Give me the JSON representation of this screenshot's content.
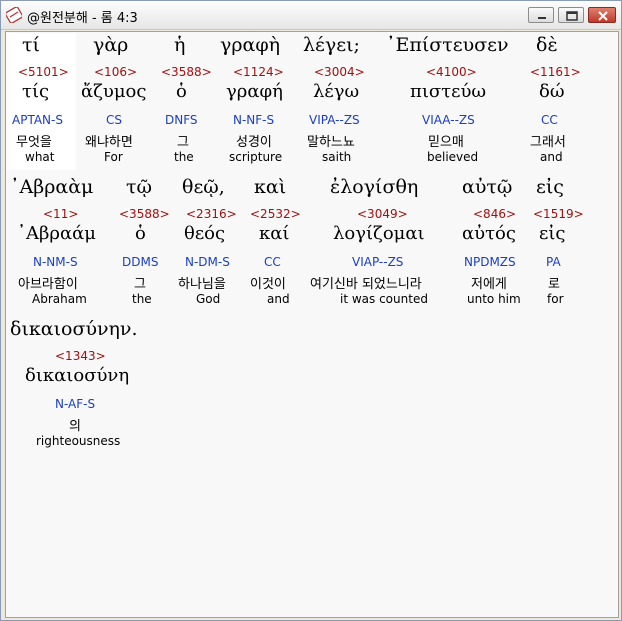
{
  "window": {
    "title": "@원전분해 - 롬 4:3",
    "minimize_label": "minimize",
    "maximize_label": "maximize",
    "close_label": "close"
  },
  "words": [
    {
      "greek": "τί",
      "strong": "<5101>",
      "lemma": "τίς",
      "parse": "APTAN-S",
      "korean": "무엇을",
      "english": "what"
    },
    {
      "greek": "γὰρ",
      "strong": "<106>",
      "lemma": "ἄζυμος",
      "parse": "CS",
      "korean": "왜냐하면",
      "english": "For"
    },
    {
      "greek": "ἡ",
      "strong": "<3588>",
      "lemma": "ὁ",
      "parse": "DNFS",
      "korean": "그",
      "english": "the"
    },
    {
      "greek": "γραφὴ",
      "strong": "<1124>",
      "lemma": "γραφή",
      "parse": "N-NF-S",
      "korean": "성경이",
      "english": "scripture"
    },
    {
      "greek": "λέγει;",
      "strong": "<3004>",
      "lemma": "λέγω",
      "parse": "VIPA--ZS",
      "korean": "말하느뇨",
      "english": "saith"
    },
    {
      "greek": "᾿Επίστευσεν",
      "strong": "<4100>",
      "lemma": "πιστεύω",
      "parse": "VIAA--ZS",
      "korean": "믿으매",
      "english": "believed"
    },
    {
      "greek": "δὲ",
      "strong": "<1161>",
      "lemma": "δώ",
      "parse": "CC",
      "korean": "그래서",
      "english": "and"
    },
    {
      "greek": "᾿Αβραὰμ",
      "strong": "<11>",
      "lemma": "᾿Αβραάμ",
      "parse": "N-NM-S",
      "korean": "아브라함이",
      "english": "Abraham"
    },
    {
      "greek": "τῷ",
      "strong": "<3588>",
      "lemma": "ὁ",
      "parse": "DDMS",
      "korean": "그",
      "english": "the"
    },
    {
      "greek": "θεῷ,",
      "strong": "<2316>",
      "lemma": "θεός",
      "parse": "N-DM-S",
      "korean": "하나님을",
      "english": "God"
    },
    {
      "greek": "καὶ",
      "strong": "<2532>",
      "lemma": "καί",
      "parse": "CC",
      "korean": "이것이",
      "english": "and"
    },
    {
      "greek": "ἐλογίσθη",
      "strong": "<3049>",
      "lemma": "λογίζομαι",
      "parse": "VIAP--ZS",
      "korean": "여기신바 되었느니라",
      "english": "it was counted"
    },
    {
      "greek": "αὐτῷ",
      "strong": "<846>",
      "lemma": "αὐτός",
      "parse": "NPDMZS",
      "korean": "저에게",
      "english": "unto him"
    },
    {
      "greek": "εἰς",
      "strong": "<1519>",
      "lemma": "εἰς",
      "parse": "PA",
      "korean": "로",
      "english": "for"
    },
    {
      "greek": "δικαιοσύνην.",
      "strong": "<1343>",
      "lemma": "δικαιοσύνη",
      "parse": "N-AF-S",
      "korean": "의",
      "english": "righteousness"
    }
  ]
}
